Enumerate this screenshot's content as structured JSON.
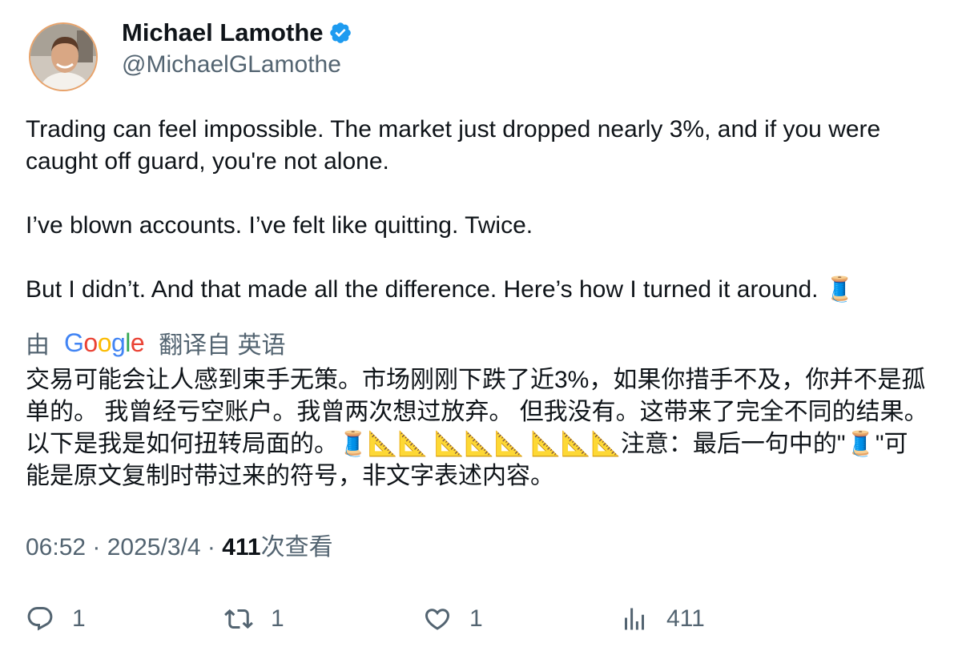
{
  "author": {
    "name": "Michael Lamothe",
    "handle": "@MichaelGLamothe",
    "verified": true
  },
  "tweet": {
    "text": "Trading can feel impossible. The market just dropped nearly 3%, and if you were caught off guard, you're not alone.\n\nI’ve blown accounts. I’ve felt like quitting. Twice.\n\nBut I didn’t. And that made all the difference. Here’s how I turned it around. 🧵"
  },
  "translation": {
    "prefix": "由",
    "provider": "Google",
    "suffix": "翻译自 英语",
    "text": "交易可能会让人感到束手无策。市场刚刚下跌了近3%，如果你措手不及，你并不是孤单的。 我曾经亏空账户。我曾两次想过放弃。 但我没有。这带来了完全不同的结果。以下是我是如何扭转局面的。🧵📐📐 📐📐📐 📐📐📐注意：最后一句中的\"🧵\"可能是原文复制时带过来的符号，非文字表述内容。"
  },
  "meta": {
    "time": "06:52",
    "date": "2025/3/4",
    "views_count": "411",
    "views_label": "次查看"
  },
  "actions": {
    "reply_count": "1",
    "retweet_count": "1",
    "like_count": "1",
    "views_count": "411"
  },
  "colors": {
    "text": "#0f1419",
    "secondary": "#536471",
    "verified": "#1d9bf0",
    "google_blue": "#4285F4",
    "google_red": "#EA4335",
    "google_yellow": "#FBBC05",
    "google_green": "#34A853"
  },
  "icons": [
    "verified-badge-icon",
    "reply-icon",
    "retweet-icon",
    "like-icon",
    "views-icon"
  ]
}
